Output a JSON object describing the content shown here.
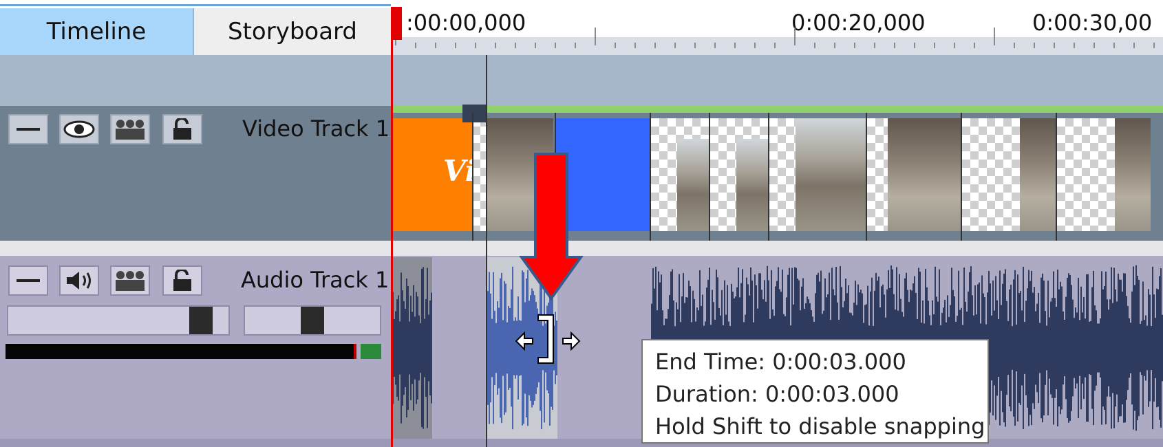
{
  "tabs": [
    {
      "label": "Timeline",
      "active": true
    },
    {
      "label": "Storyboard",
      "active": false
    }
  ],
  "ruler": {
    "time_labels": [
      ":00:00,000",
      "0:00:20,000",
      "0:00:30,00"
    ]
  },
  "tracks": {
    "video": {
      "label": "Video Track 1",
      "buttons": [
        "minimize-icon",
        "eye-icon",
        "group-icon",
        "lock-open-icon"
      ],
      "clip_title_fragment": "Vi"
    },
    "audio": {
      "label": "Audio Track 1",
      "buttons": [
        "minimize-icon",
        "speaker-icon",
        "group-icon",
        "lock-open-icon"
      ],
      "volume_level": 0.92,
      "pan_level": 0.5
    }
  },
  "tooltip": {
    "end_time": "End Time: 0:00:03.000",
    "duration": "Duration: 0:00:03.000",
    "hint": "Hold Shift to disable snapping"
  },
  "colors": {
    "tab_active": "#a9d6fb",
    "playhead": "#e00000",
    "video_track_bg": "#6f8090",
    "audio_track_bg": "#aeaac6",
    "orange_clip": "#ff8000",
    "blue_clip": "#3366ff",
    "waveform": "#2f3a5f",
    "selected_audio": "#4a66b0",
    "arrow": "#ff0000",
    "clip_green_bar": "#8fd16a"
  }
}
